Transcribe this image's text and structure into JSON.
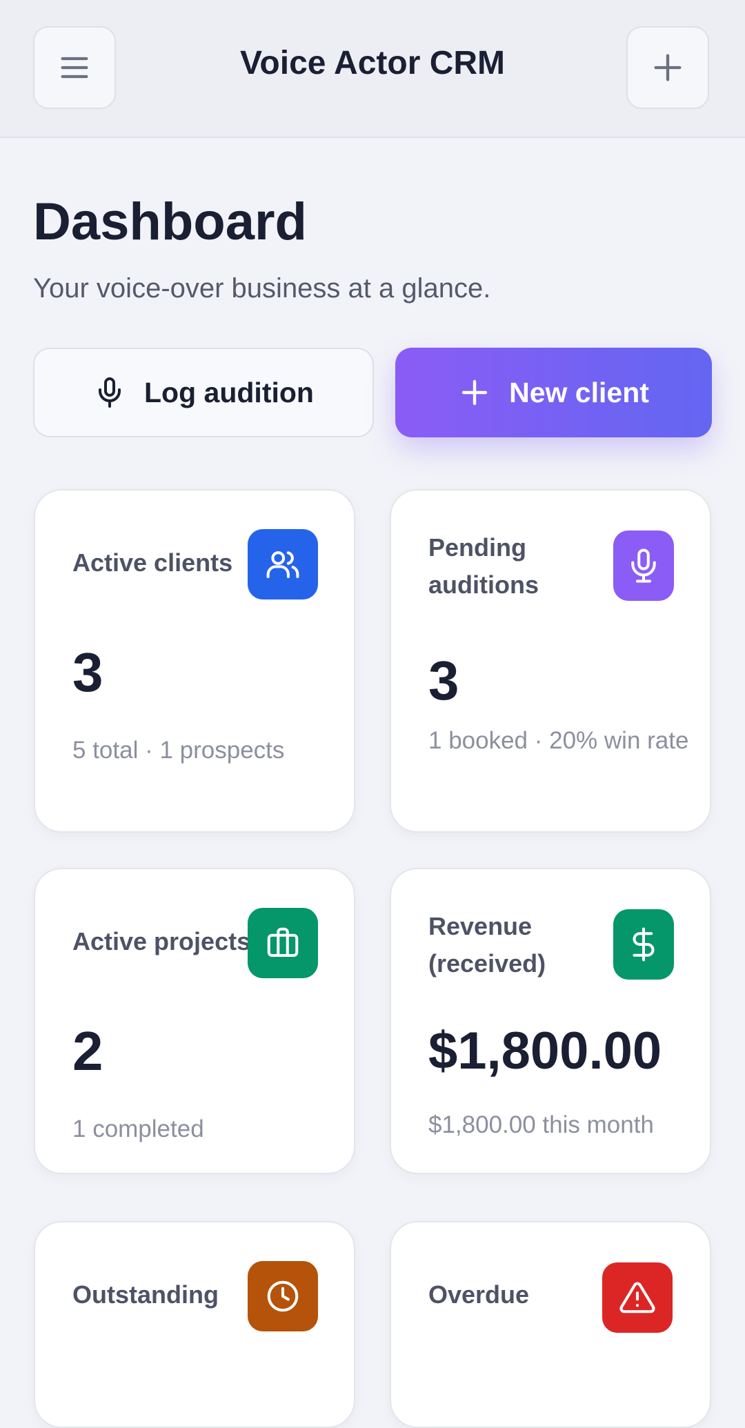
{
  "header": {
    "title": "Voice Actor CRM",
    "menu_icon": "menu-icon",
    "add_icon": "plus-icon"
  },
  "page": {
    "title": "Dashboard",
    "subtitle": "Your voice-over business at a glance."
  },
  "actions": {
    "log_audition": "Log audition",
    "new_client": "New client"
  },
  "colors": {
    "primary_gradient_start": "#8b5cf6",
    "primary_gradient_end": "#6366f1",
    "blue": "#2563eb",
    "purple": "#8b5cf6",
    "green": "#059669",
    "amber": "#b45309",
    "red": "#dc2626"
  },
  "cards": [
    {
      "label": "Active clients",
      "value": "3",
      "sub": "5 total · 1 prospects",
      "icon": "users-icon"
    },
    {
      "label": "Pending auditions",
      "value": "3",
      "sub": "1 booked · 20% win rate",
      "icon": "microphone-icon"
    },
    {
      "label": "Active projects",
      "value": "2",
      "sub": "1 completed",
      "icon": "briefcase-icon"
    },
    {
      "label": "Revenue (received)",
      "value": "$1,800.00",
      "sub": "$1,800.00 this month",
      "icon": "dollar-icon"
    },
    {
      "label": "Outstanding",
      "icon": "clock-icon"
    },
    {
      "label": "Overdue",
      "icon": "alert-triangle-icon"
    }
  ]
}
